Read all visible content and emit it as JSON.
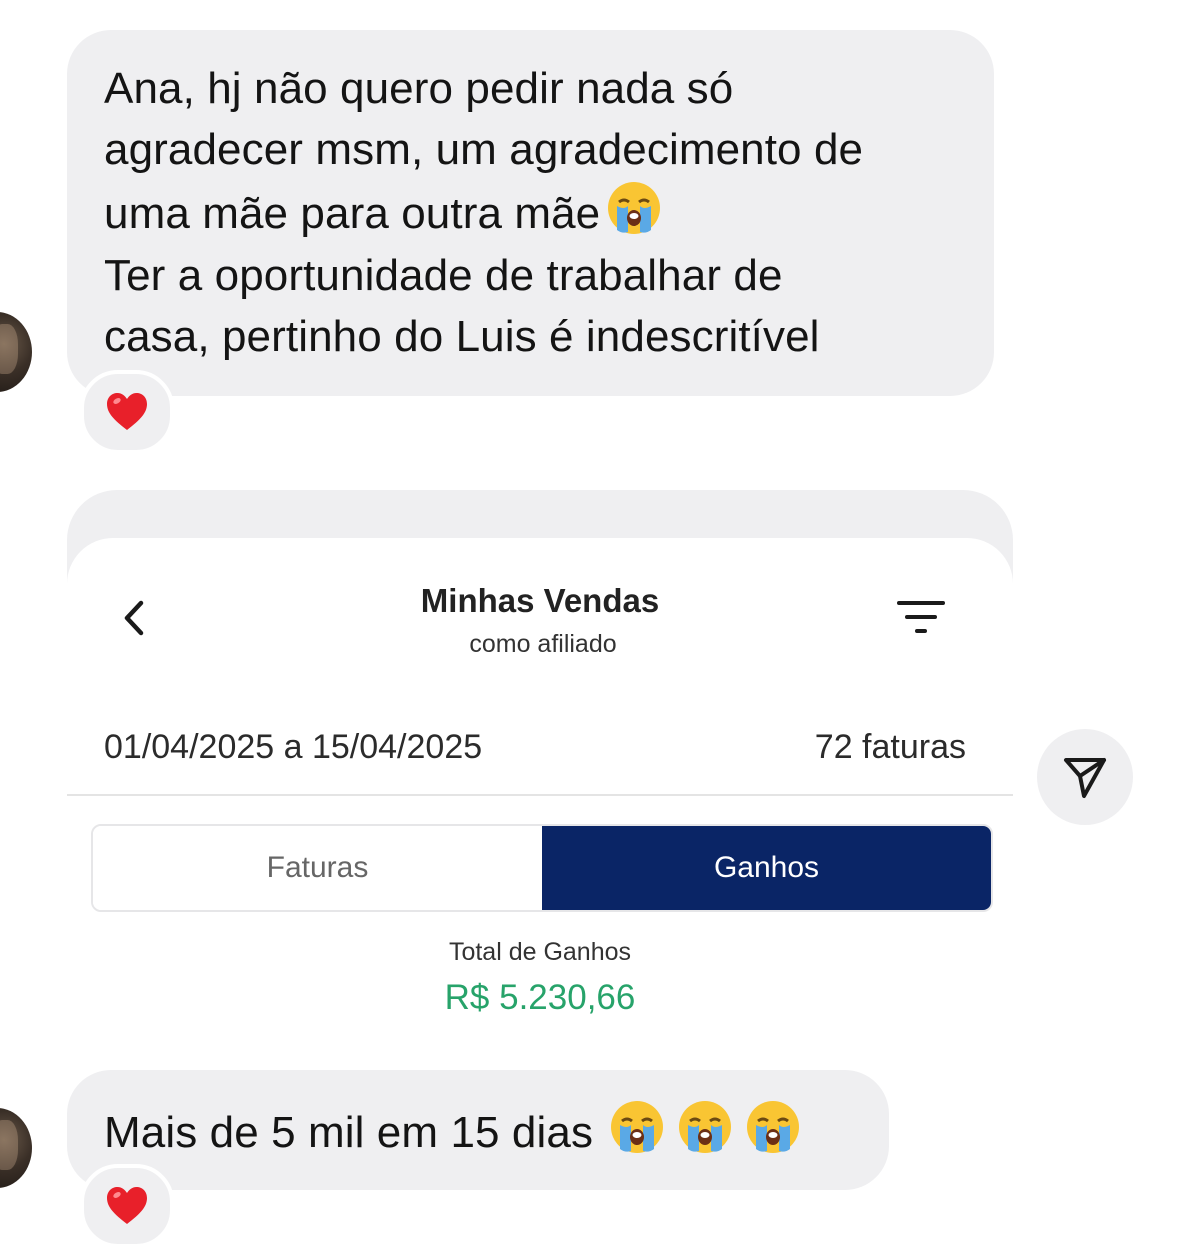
{
  "messages": {
    "first": {
      "lines": [
        "Ana, hj não quero pedir nada só",
        "agradecer msm, um agradecimento de",
        "uma mãe para outra mãe",
        "Ter a oportunidade de trabalhar de",
        "casa, pertinho do Luis é indescritível"
      ],
      "emoji": "loudly-crying-face",
      "reaction": "red-heart"
    },
    "second": {
      "text": "Mais de 5 mil em 15 dias",
      "emojis": [
        "loudly-crying-face",
        "loudly-crying-face",
        "loudly-crying-face"
      ],
      "reaction": "red-heart"
    }
  },
  "shared_screen": {
    "title": "Minhas Vendas",
    "subtitle": "como afiliado",
    "date_range": "01/04/2025 a 15/04/2025",
    "invoice_count": "72 faturas",
    "tabs": [
      {
        "label": "Faturas",
        "active": false
      },
      {
        "label": "Ganhos",
        "active": true
      }
    ],
    "total_label": "Total de Ganhos",
    "total_value": "R$ 5.230,66"
  },
  "colors": {
    "bubble_bg": "#efeff1",
    "active_tab": "#0a2566",
    "earnings_green": "#27a36a"
  },
  "icons": {
    "back": "chevron-left-icon",
    "filter": "filter-icon",
    "share": "send-icon"
  }
}
